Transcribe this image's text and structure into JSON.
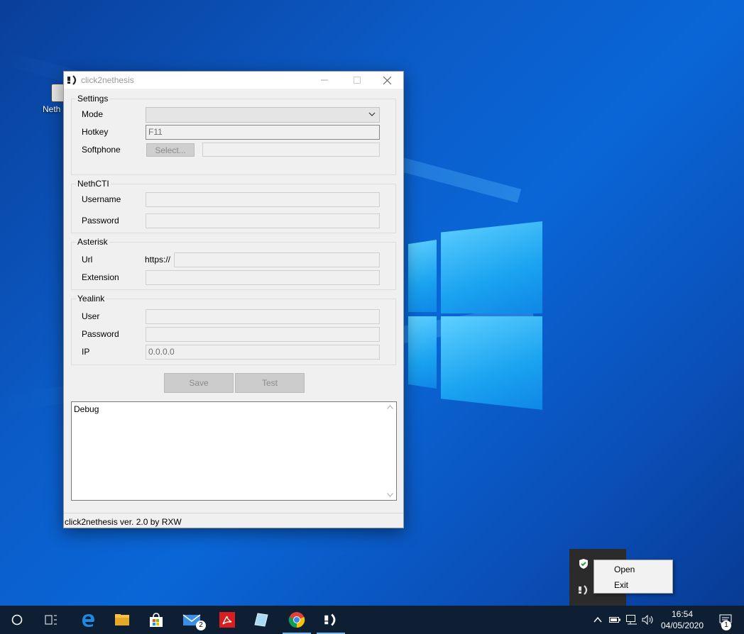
{
  "desktop": {
    "icon_label": "Neth"
  },
  "window": {
    "title": "click2nethesis",
    "settings": {
      "group_title": "Settings",
      "mode_label": "Mode",
      "mode_value": "",
      "hotkey_label": "Hotkey",
      "hotkey_value": "F11",
      "softphone_label": "Softphone",
      "select_button": "Select...",
      "softphone_value": ""
    },
    "nethcti": {
      "group_title": "NethCTI",
      "username_label": "Username",
      "username_value": "",
      "password_label": "Password",
      "password_value": ""
    },
    "asterisk": {
      "group_title": "Asterisk",
      "url_label": "Url",
      "url_prefix": "https://",
      "url_value": "",
      "extension_label": "Extension",
      "extension_value": ""
    },
    "yealink": {
      "group_title": "Yealink",
      "user_label": "User",
      "user_value": "",
      "password_label": "Password",
      "password_value": "",
      "ip_label": "IP",
      "ip_value": "0.0.0.0"
    },
    "buttons": {
      "save": "Save",
      "test": "Test"
    },
    "debug_text": "Debug",
    "status_text": "click2nethesis ver. 2.0 by RXW"
  },
  "context_menu": {
    "items": [
      "Open",
      "Exit"
    ]
  },
  "taskbar": {
    "icons": [
      "search-icon",
      "task-view-icon",
      "edge-icon",
      "file-explorer-icon",
      "store-icon",
      "mail-icon",
      "acrobat-icon",
      "notepad-icon",
      "chrome-icon",
      "click2nethesis-icon"
    ],
    "mail_badge": "2",
    "notification_badge": "1",
    "time": "16:54",
    "date": "04/05/2020"
  },
  "colors": {
    "desktop_blue": "#0a66d6",
    "taskbar": "#0e1e33",
    "window_bg": "#f0f0f0",
    "disabled_text": "#8b8b8b"
  }
}
